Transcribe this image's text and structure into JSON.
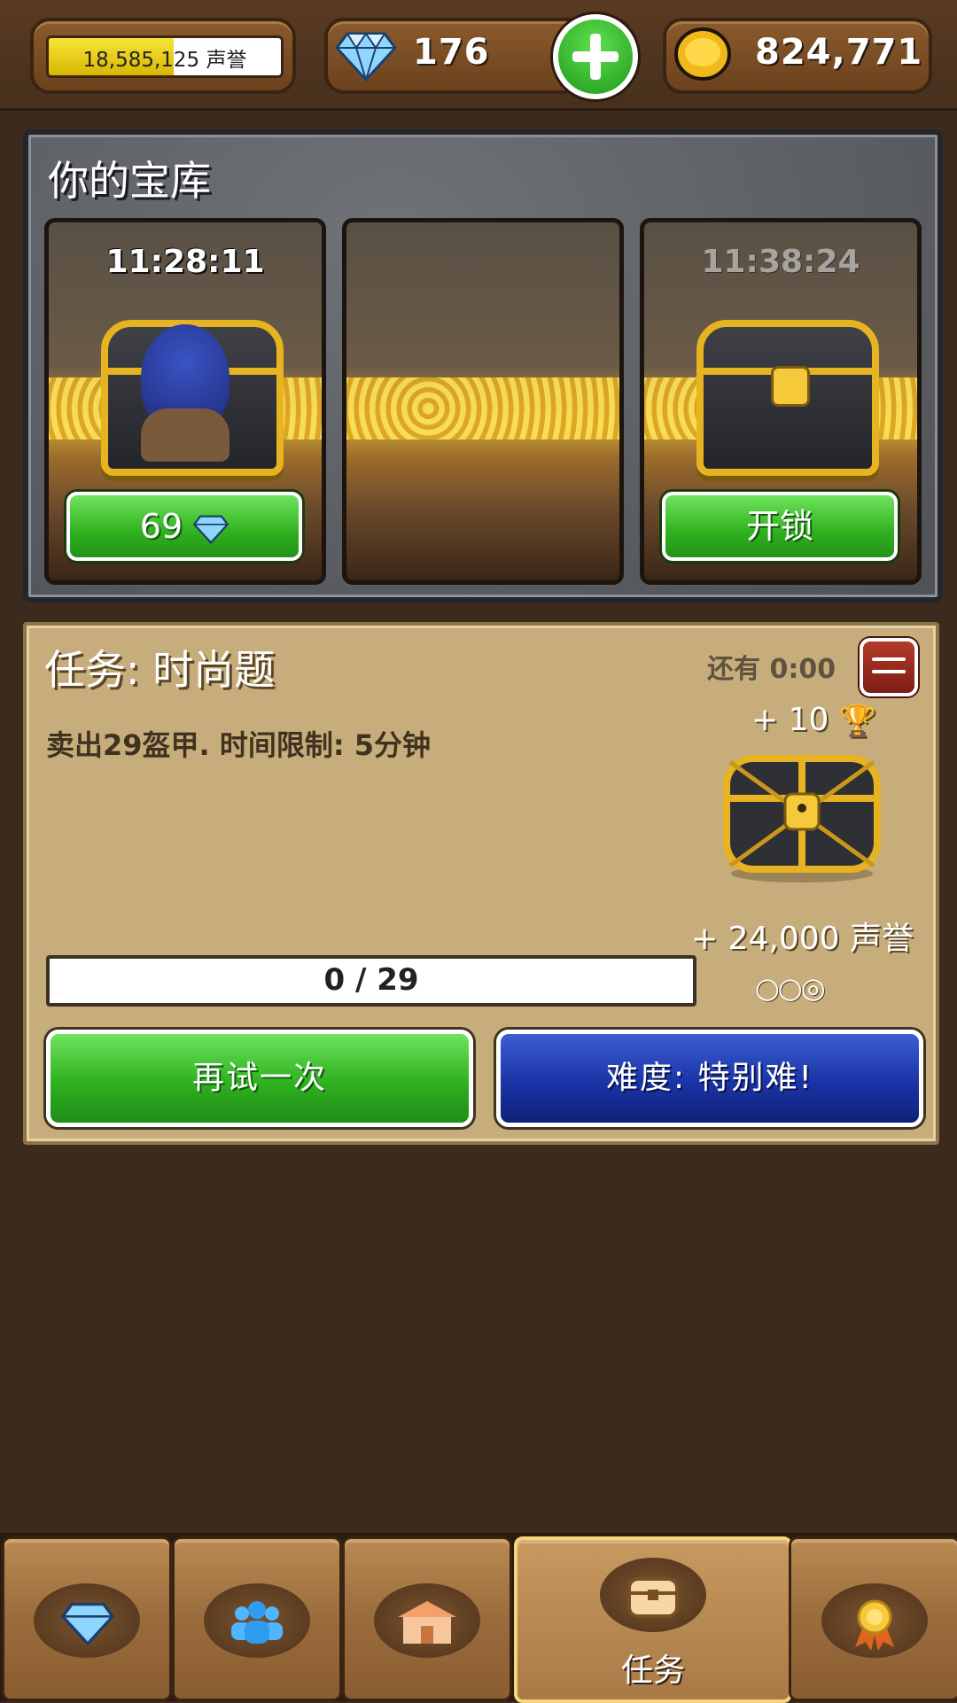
{
  "top_bar": {
    "reputation": {
      "text": "18,585,125 声誉",
      "fill_fraction": 0.54
    },
    "gems": {
      "value": "176"
    },
    "gold": {
      "value": "824,771"
    }
  },
  "vault": {
    "title": "你的宝库",
    "slots": [
      {
        "timer": "11:28:11",
        "button_value": "69",
        "button_icon": "gem-icon"
      },
      {
        "timer": "",
        "button_value": ""
      },
      {
        "timer": "11:38:24",
        "button_label": "开锁"
      }
    ]
  },
  "quest": {
    "title": "任务: 时尚题",
    "time_left": "还有 0:00",
    "description": "卖出29盔甲. 时间限制: 5分钟",
    "trophy_reward": "+ 10",
    "reputation_reward": "+ 24,000 声誉",
    "stars": "○○◎",
    "progress": {
      "text": "0 / 29",
      "current": 0,
      "total": 29
    },
    "retry_label": "再试一次",
    "difficulty_label": "难度: 特别难!"
  },
  "nav": {
    "tabs": [
      {
        "name": "gems",
        "icon": "gem-icon"
      },
      {
        "name": "customers",
        "icon": "people-icon"
      },
      {
        "name": "shop",
        "icon": "market-icon"
      },
      {
        "name": "quests",
        "icon": "chest-icon",
        "label": "任务",
        "active": true
      },
      {
        "name": "achievements",
        "icon": "medal-icon"
      }
    ]
  },
  "colors": {
    "green_button": "#2fb11f",
    "blue_button": "#1a34a6",
    "parchment": "#c6ad7b",
    "background": "#3d2a1e"
  }
}
